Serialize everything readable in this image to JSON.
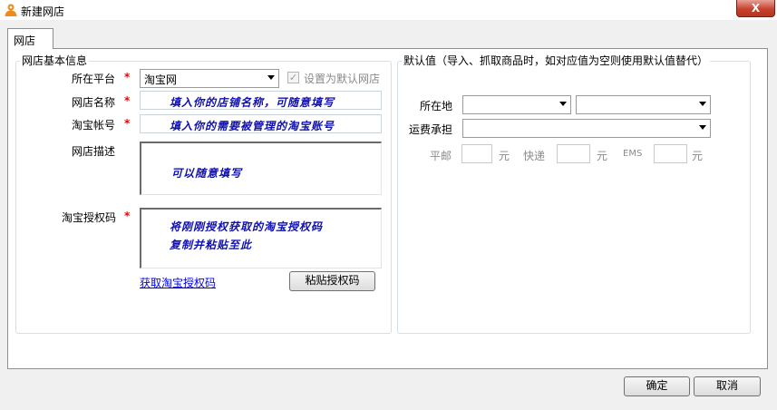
{
  "window": {
    "title": "新建网店",
    "close": "X"
  },
  "tab": {
    "label": "网店"
  },
  "basic": {
    "legend": "网店基本信息",
    "platform": {
      "label": "所在平台",
      "required": "*",
      "value": "淘宝网",
      "default_checkbox_label": "设置为默认网店"
    },
    "shop_name": {
      "label": "网店名称",
      "required": "*",
      "hint": "填入你的店铺名称，可随意填写"
    },
    "account": {
      "label": "淘宝帐号",
      "required": "*",
      "hint": "填入你的需要被管理的淘宝账号"
    },
    "description": {
      "label": "网店描述",
      "hint": "可以随意填写"
    },
    "auth_code": {
      "label": "淘宝授权码",
      "required": "*",
      "hint_line1": "将刚刚授权获取的淘宝授权码",
      "hint_line2": "复制并粘贴至此"
    },
    "get_auth_link": "获取淘宝授权码",
    "paste_button": "粘贴授权码"
  },
  "defaults": {
    "legend": "默认值（导入、抓取商品时，如对应值为空则使用默认值替代）",
    "location_label": "所在地",
    "shipping_label": "运费承担",
    "post_label": "平邮",
    "express_label": "快递",
    "ems_label": "EMS",
    "unit": "元"
  },
  "footer": {
    "ok": "确定",
    "cancel": "取消"
  }
}
